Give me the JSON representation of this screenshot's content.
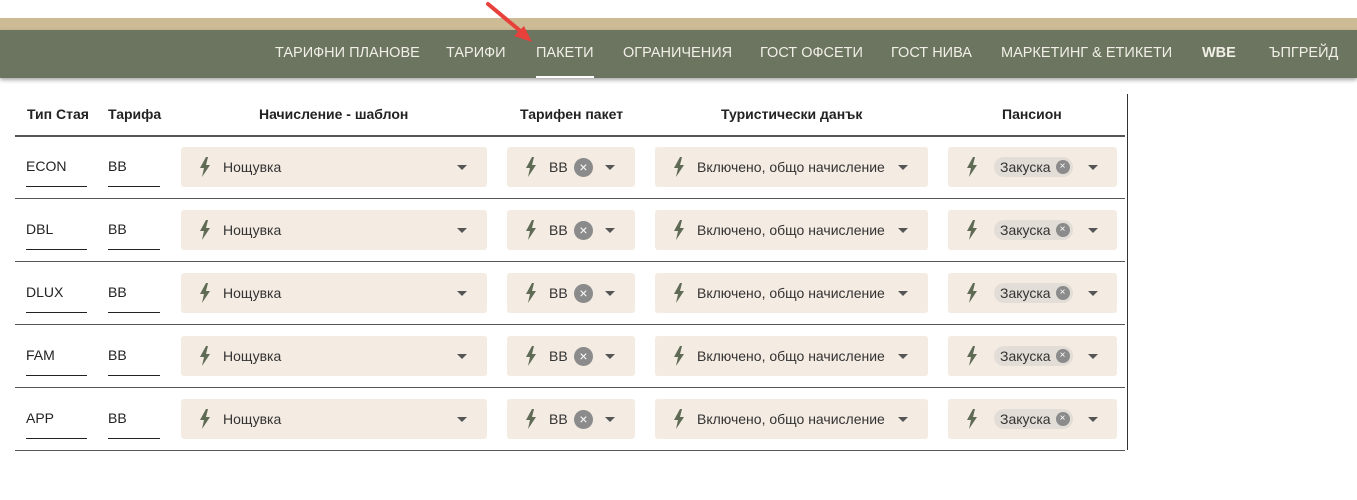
{
  "nav": {
    "items": [
      {
        "label": "ТАРИФНИ ПЛАНОВЕ",
        "active": false
      },
      {
        "label": "ТАРИФИ",
        "active": false
      },
      {
        "label": "ПАКЕТИ",
        "active": true
      },
      {
        "label": "ОГРАНИЧЕНИЯ",
        "active": false
      },
      {
        "label": "ГОСТ ОФСЕТИ",
        "active": false
      },
      {
        "label": "ГОСТ НИВА",
        "active": false
      },
      {
        "label": "МАРКЕТИНГ & ЕТИКЕТИ",
        "active": false
      },
      {
        "label": "WBE",
        "active": false
      },
      {
        "label": "ЪПГРЕЙД",
        "active": false
      }
    ]
  },
  "colors": {
    "nav_bg": "#6b7560",
    "top_band": "#cdbb96",
    "select_bg": "#f4ebe2",
    "arrow": "#e8403a",
    "icon": "#5f6b55"
  },
  "table": {
    "headers": {
      "room_type": "Тип Стая",
      "rate": "Тарифа",
      "charge_template": "Начисление - шаблон",
      "rate_package": "Тарифен пакет",
      "tourist_tax": "Туристически данък",
      "board": "Пансион"
    },
    "rows": [
      {
        "room_type": "ECON",
        "rate": "BB",
        "charge_template": "Нощувка",
        "rate_package": "BB",
        "tourist_tax": "Включено, общо начисление",
        "board": "Закуска"
      },
      {
        "room_type": "DBL",
        "rate": "BB",
        "charge_template": "Нощувка",
        "rate_package": "BB",
        "tourist_tax": "Включено, общо начисление",
        "board": "Закуска"
      },
      {
        "room_type": "DLUX",
        "rate": "BB",
        "charge_template": "Нощувка",
        "rate_package": "BB",
        "tourist_tax": "Включено, общо начисление",
        "board": "Закуска"
      },
      {
        "room_type": "FAM",
        "rate": "BB",
        "charge_template": "Нощувка",
        "rate_package": "BB",
        "tourist_tax": "Включено, общо начисление",
        "board": "Закуска"
      },
      {
        "room_type": "APP",
        "rate": "BB",
        "charge_template": "Нощувка",
        "rate_package": "BB",
        "tourist_tax": "Включено, общо начисление",
        "board": "Закуска"
      }
    ]
  },
  "icons": {
    "field_icon": "lightning-bolt-icon",
    "clear_icon": "clear-circle-icon",
    "dropdown_icon": "caret-down-icon",
    "annotation": "red-arrow-annotation-icon"
  }
}
